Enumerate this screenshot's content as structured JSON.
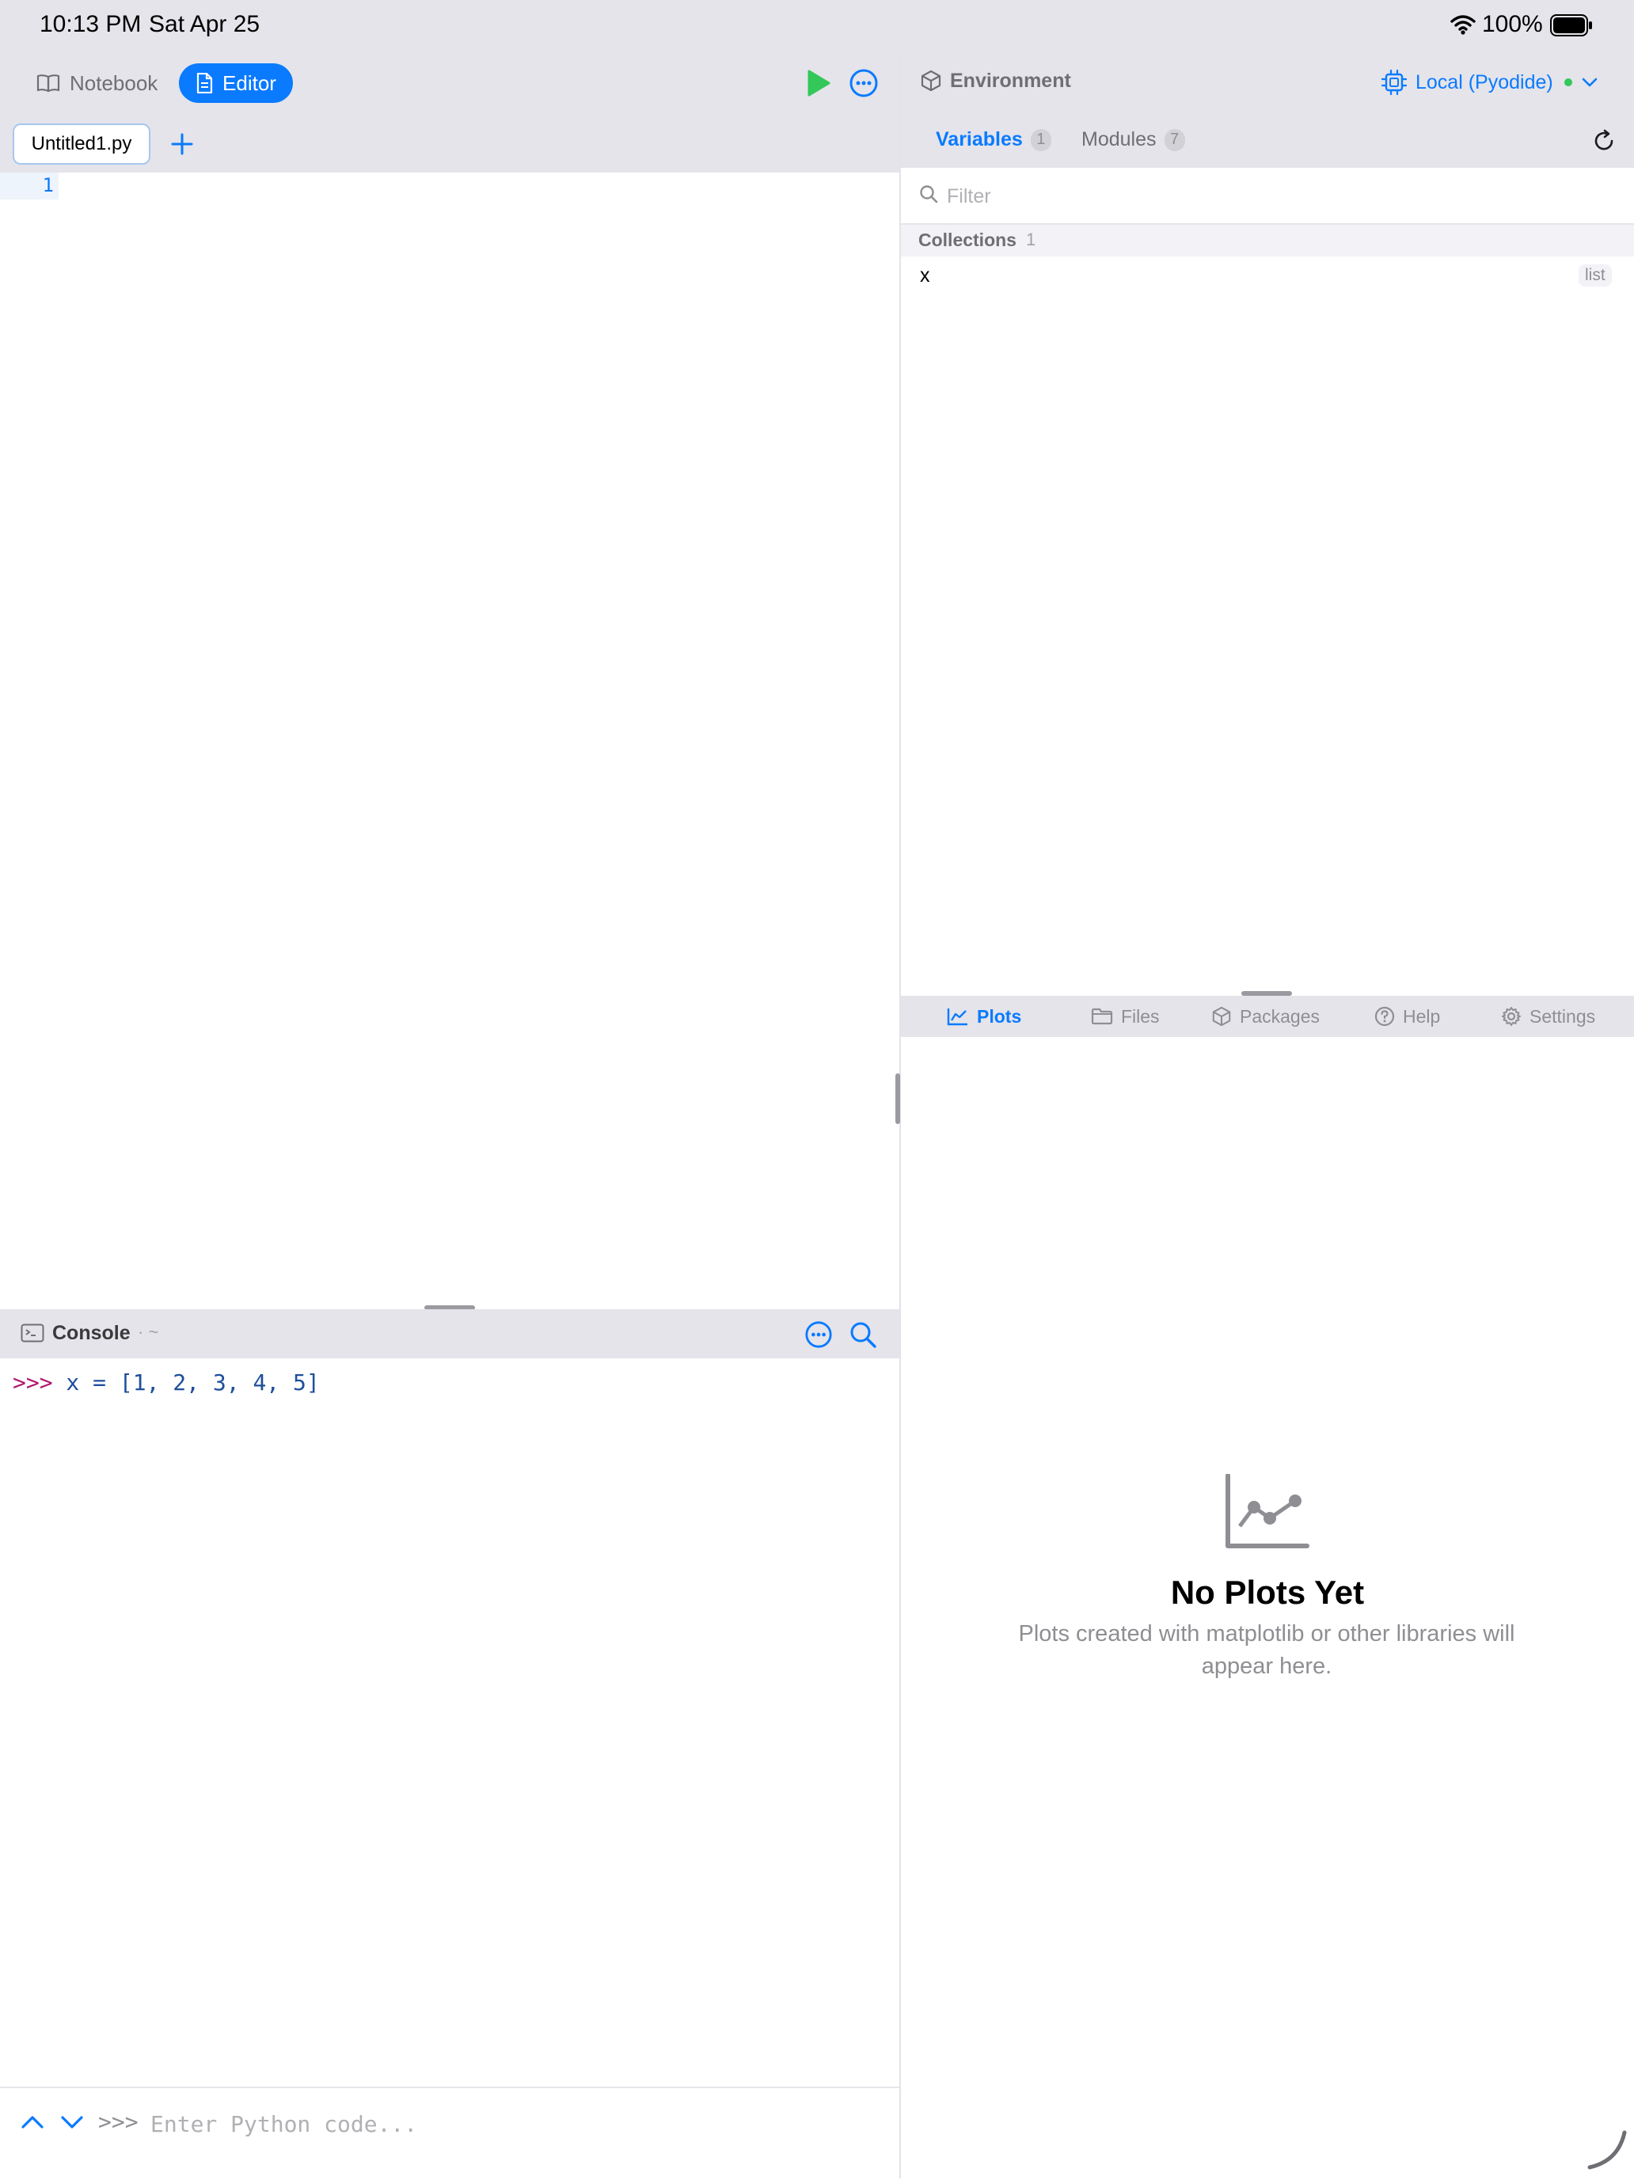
{
  "status_bar": {
    "time": "10:13 PM",
    "date": "Sat Apr 25",
    "battery": "100%"
  },
  "toolbar": {
    "notebook_label": "Notebook",
    "editor_label": "Editor"
  },
  "editor": {
    "file_tab": "Untitled1.py",
    "line_number": "1"
  },
  "console": {
    "title": "Console",
    "path": "· ~",
    "output": {
      "prompt": ">>>",
      "code": " x = [1, 2, 3, 4, 5]"
    },
    "input_prompt": ">>>",
    "input_placeholder": "Enter Python code..."
  },
  "environment": {
    "title": "Environment",
    "runtime": "Local (Pyodide)",
    "tabs": {
      "variables": "Variables",
      "variables_count": "1",
      "modules": "Modules",
      "modules_count": "7"
    },
    "filter_placeholder": "Filter",
    "collections_label": "Collections",
    "collections_count": "1",
    "variable": {
      "name": "x",
      "type": "list"
    }
  },
  "bottom_tabs": {
    "plots": "Plots",
    "files": "Files",
    "packages": "Packages",
    "help": "Help",
    "settings": "Settings"
  },
  "plots": {
    "empty_title": "No Plots Yet",
    "empty_desc": "Plots created with matplotlib or other libraries will appear here."
  },
  "colors": {
    "accent": "#0a7aff",
    "run": "#34c759",
    "status_dot": "#34c759"
  }
}
